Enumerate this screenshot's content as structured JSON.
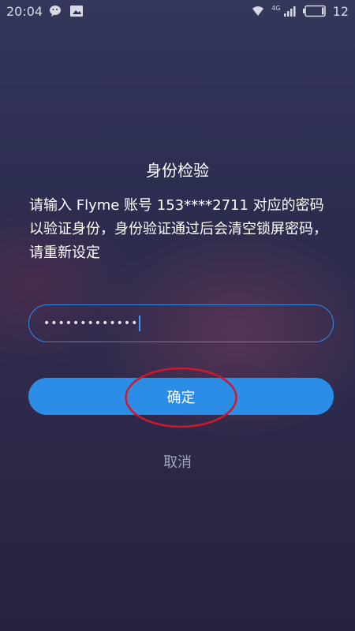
{
  "status_bar": {
    "time": "20:04",
    "network": "4G",
    "battery_level": "12",
    "icons": [
      "wechat-icon",
      "notification-icon",
      "wifi-icon",
      "signal-icon",
      "battery-icon"
    ]
  },
  "dialog": {
    "title": "身份检验",
    "description": "请输入 Flyme 账号 153****2711 对应的密码以验证身份，身份验证通过后会清空锁屏密码，请重新设定",
    "password_value": "•••••••••••••",
    "confirm_label": "确定",
    "cancel_label": "取消"
  },
  "colors": {
    "accent": "#2b8de6",
    "annotation": "#d0182b"
  }
}
